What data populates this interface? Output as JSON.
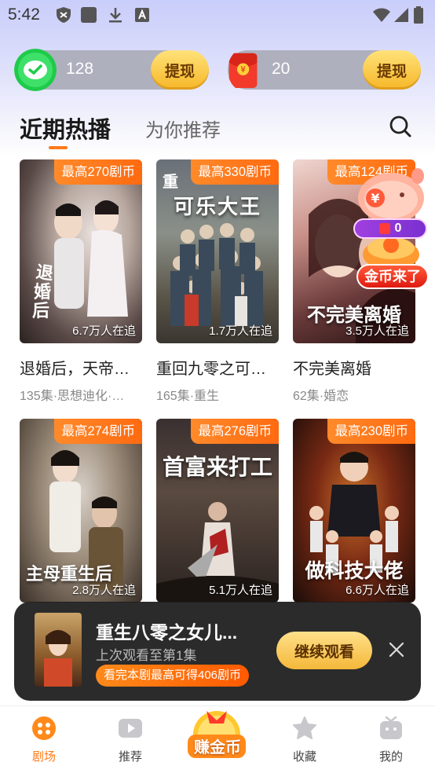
{
  "status_bar": {
    "time": "5:42"
  },
  "wallet": {
    "coins": {
      "amount": "128",
      "button": "提现",
      "icon": "wechat-icon"
    },
    "redpacket": {
      "amount": "20",
      "button": "提现",
      "icon": "red-packet-icon"
    }
  },
  "tabs": {
    "active": "近期热播",
    "other": "为你推荐"
  },
  "cards": [
    {
      "tag": "最高270剧币",
      "followers": "6.7万人在追",
      "title": "退婚后，天帝…",
      "meta": "135集·思想迪化·…"
    },
    {
      "tag": "最高330剧币",
      "followers": "1.7万人在追",
      "title": "重回九零之可…",
      "meta": "165集·重生",
      "poster_text": "可乐大王"
    },
    {
      "tag": "最高124剧币",
      "followers": "3.5万人在追",
      "title": "不完美离婚",
      "meta": "62集·婚恋",
      "poster_text": "不完美离婚"
    },
    {
      "tag": "最高274剧币",
      "followers": "2.8万人在追",
      "title": "",
      "meta": "",
      "poster_text": "主母重生后"
    },
    {
      "tag": "最高276剧币",
      "followers": "5.1万人在追",
      "title": "",
      "meta": "",
      "poster_text": "首富来打工"
    },
    {
      "tag": "最高230剧币",
      "followers": "6.6万人在追",
      "title": "",
      "meta": "",
      "poster_text": "做科技大佬"
    }
  ],
  "gold_widget": {
    "count": "0",
    "label": "金币来了"
  },
  "resume": {
    "title": "重生八零之女儿...",
    "progress": "上次观看至第1集",
    "reward": "看完本剧最高可得406剧币",
    "button": "继续观看"
  },
  "nav": {
    "theater": "剧场",
    "recommend": "推荐",
    "earn": "赚金币",
    "favorites": "收藏",
    "mine": "我的"
  },
  "colors": {
    "accent": "#ff7a1a",
    "tag": "#ff6a10"
  }
}
